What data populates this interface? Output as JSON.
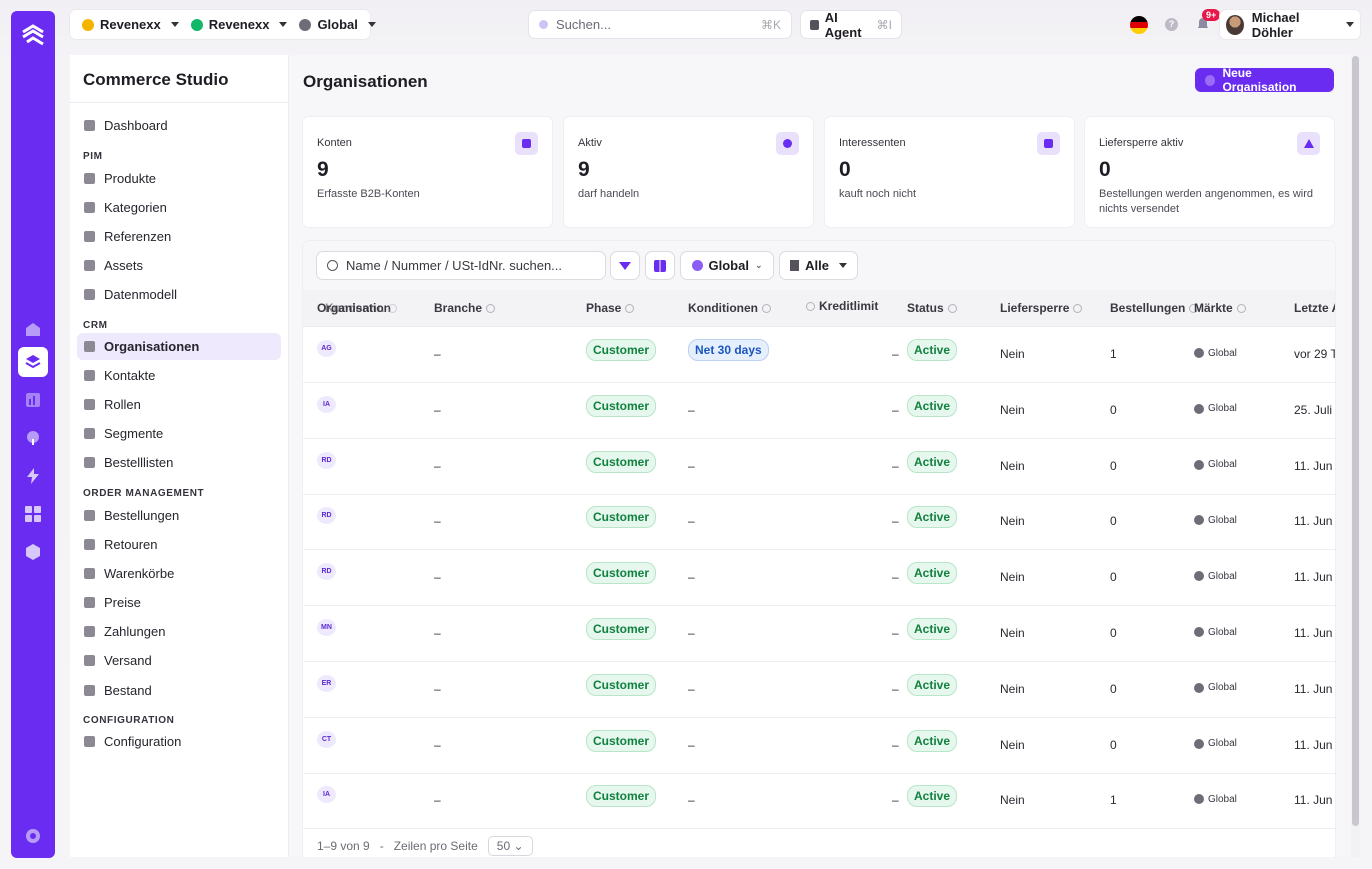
{
  "topbar": {
    "tenant1": "Revenexx",
    "tenant2": "Revenexx",
    "scope": "Global",
    "search_placeholder": "Suchen...",
    "search_shortcut": "⌘K",
    "ai_agent": "AI Agent",
    "ai_shortcut": "⌘I",
    "notif_badge": "9+",
    "user_name": "Michael Döhler"
  },
  "sidebar": {
    "title": "Commerce Studio",
    "dashboard": "Dashboard",
    "sections": {
      "pim": "PIM",
      "crm": "CRM",
      "order": "ORDER MANAGEMENT",
      "config": "CONFIGURATION"
    },
    "pim_items": [
      "Produkte",
      "Kategorien",
      "Referenzen",
      "Assets",
      "Datenmodell"
    ],
    "crm_items": [
      "Organisationen",
      "Kontakte",
      "Rollen",
      "Segmente",
      "Bestelllisten"
    ],
    "order_items": [
      "Bestellungen",
      "Retouren",
      "Warenkörbe",
      "Preise",
      "Zahlungen",
      "Versand",
      "Bestand"
    ],
    "config_items": [
      "Configuration"
    ]
  },
  "page": {
    "title": "Organisationen",
    "new_button": "Neue Organisation"
  },
  "stats": [
    {
      "label": "Konten",
      "value": "9",
      "sub": "Erfasste B2B-Konten"
    },
    {
      "label": "Aktiv",
      "value": "9",
      "sub": "darf handeln"
    },
    {
      "label": "Interessenten",
      "value": "0",
      "sub": "kauft noch nicht"
    },
    {
      "label": "Liefersperre aktiv",
      "value": "0",
      "sub": "Bestellungen werden angenommen, es wird nichts versendet"
    }
  ],
  "filters": {
    "search_placeholder": "Name / Nummer / USt-IdNr. suchen...",
    "market": "Global",
    "list": "Alle"
  },
  "columns": {
    "org": "Organisation",
    "kundennr": "Kundennr.",
    "branche": "Branche",
    "phase": "Phase",
    "konditionen": "Konditionen",
    "kreditlimit": "Kreditlimit",
    "status": "Status",
    "liefersperre": "Liefersperre",
    "bestellungen": "Bestellungen",
    "maerkte": "Märkte",
    "letzte": "Letzte A"
  },
  "rows": [
    {
      "initials": "AG",
      "branche": "–",
      "phase": "Customer",
      "konditionen": "Net 30 days",
      "kredit": "–",
      "status": "Active",
      "liefersperre": "Nein",
      "bestellungen": "1",
      "markt": "Global",
      "letzte": "vor 29 T"
    },
    {
      "initials": "IA",
      "branche": "–",
      "phase": "Customer",
      "konditionen": "–",
      "kredit": "–",
      "status": "Active",
      "liefersperre": "Nein",
      "bestellungen": "0",
      "markt": "Global",
      "letzte": "25. Juli"
    },
    {
      "initials": "RD",
      "branche": "–",
      "phase": "Customer",
      "konditionen": "–",
      "kredit": "–",
      "status": "Active",
      "liefersperre": "Nein",
      "bestellungen": "0",
      "markt": "Global",
      "letzte": "11. Jun"
    },
    {
      "initials": "RD",
      "branche": "–",
      "phase": "Customer",
      "konditionen": "–",
      "kredit": "–",
      "status": "Active",
      "liefersperre": "Nein",
      "bestellungen": "0",
      "markt": "Global",
      "letzte": "11. Jun"
    },
    {
      "initials": "RD",
      "branche": "–",
      "phase": "Customer",
      "konditionen": "–",
      "kredit": "–",
      "status": "Active",
      "liefersperre": "Nein",
      "bestellungen": "0",
      "markt": "Global",
      "letzte": "11. Jun"
    },
    {
      "initials": "MN",
      "branche": "–",
      "phase": "Customer",
      "konditionen": "–",
      "kredit": "–",
      "status": "Active",
      "liefersperre": "Nein",
      "bestellungen": "0",
      "markt": "Global",
      "letzte": "11. Jun"
    },
    {
      "initials": "ER",
      "branche": "–",
      "phase": "Customer",
      "konditionen": "–",
      "kredit": "–",
      "status": "Active",
      "liefersperre": "Nein",
      "bestellungen": "0",
      "markt": "Global",
      "letzte": "11. Jun"
    },
    {
      "initials": "CT",
      "branche": "–",
      "phase": "Customer",
      "konditionen": "–",
      "kredit": "–",
      "status": "Active",
      "liefersperre": "Nein",
      "bestellungen": "0",
      "markt": "Global",
      "letzte": "11. Jun"
    },
    {
      "initials": "IA",
      "branche": "–",
      "phase": "Customer",
      "konditionen": "–",
      "kredit": "–",
      "status": "Active",
      "liefersperre": "Nein",
      "bestellungen": "1",
      "markt": "Global",
      "letzte": "11. Jun"
    }
  ],
  "pagination": {
    "range": "1–9 von 9",
    "sep": "-",
    "per_page_label": "Zeilen pro Seite",
    "per_page": "50"
  },
  "colors": {
    "accent": "#6a2cf0",
    "success": "#11813f",
    "info": "#1a56c2",
    "badge": "#e8174a"
  },
  "icons": {
    "rail": [
      "home-icon",
      "layers-icon",
      "chart-icon",
      "pin-icon",
      "bolt-icon",
      "grid-icon",
      "cube-icon",
      "gear-icon"
    ]
  }
}
